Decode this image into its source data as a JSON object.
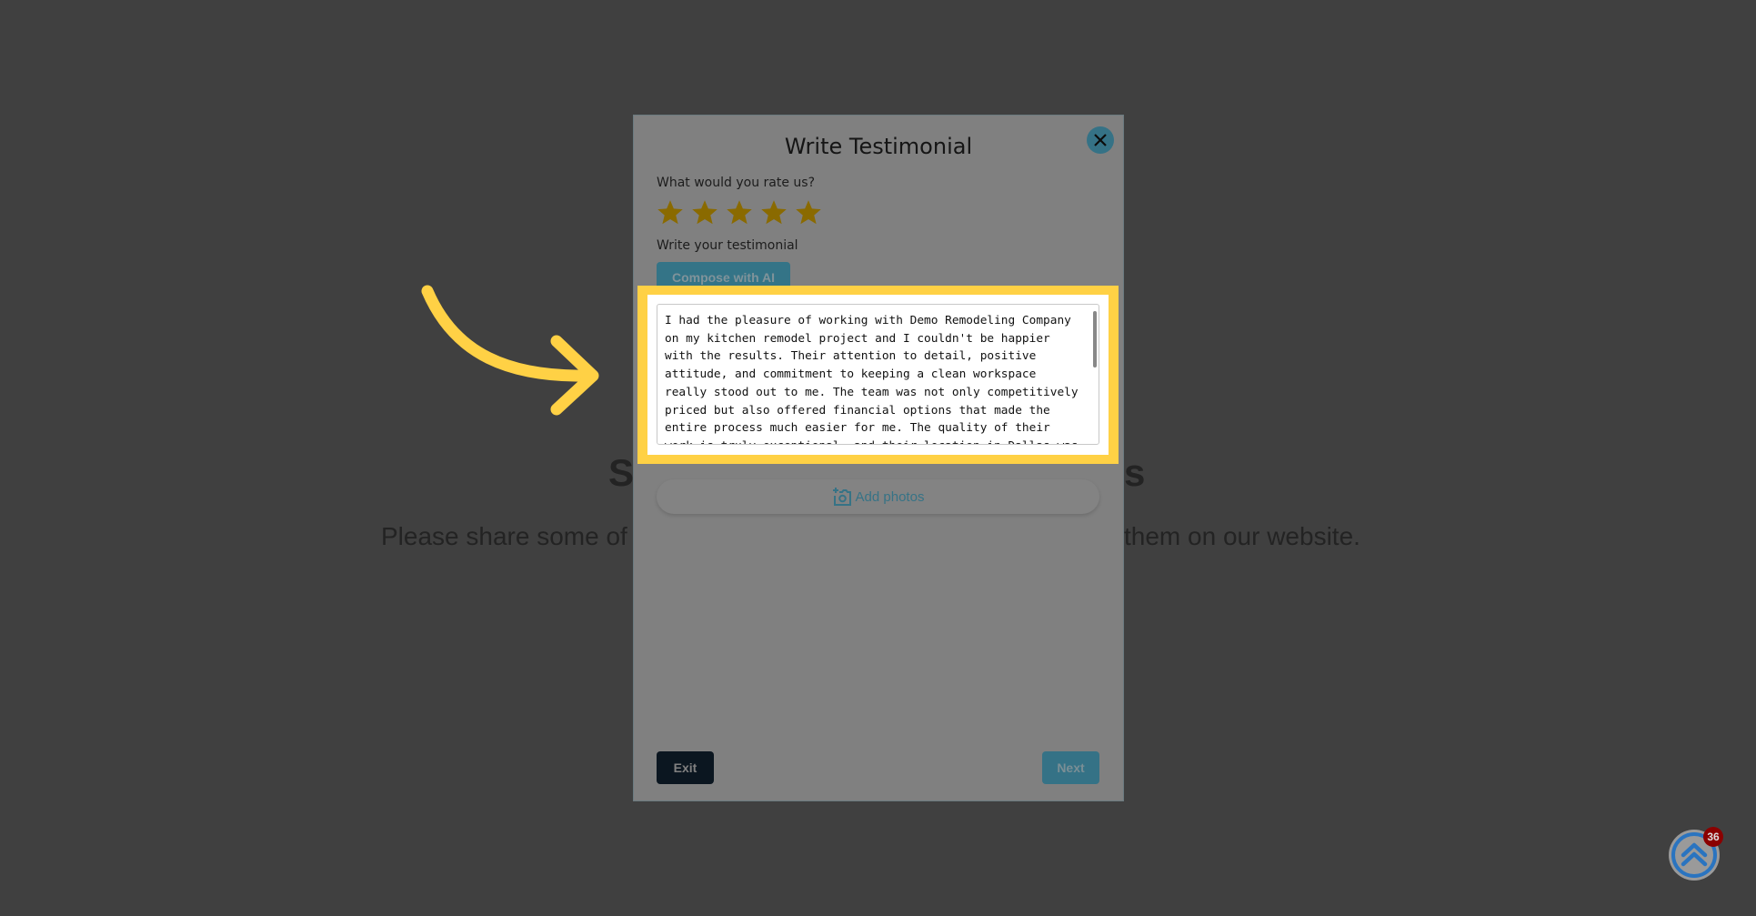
{
  "background": {
    "heading_left": "S",
    "heading_right": "s",
    "subtitle_left": "Please share some of",
    "subtitle_right": "them on our website."
  },
  "modal": {
    "title": "Write Testimonial",
    "close_icon": "close-icon",
    "rating_label": "What would you rate us?",
    "rating": 5,
    "rating_max": 5,
    "testimonial_label": "Write your testimonial",
    "compose_label": "Compose with AI",
    "testimonial_text": "I had the pleasure of working with Demo Remodeling Company on my kitchen remodel project and I couldn't be happier with the results. Their attention to detail, positive attitude, and commitment to keeping a clean workspace really stood out to me. The team was not only competitively priced but also offered financial options that made the entire process much easier for me. The quality of their work is truly exceptional, and their location in Dallas was conveniently",
    "add_photos_label": "Add photos",
    "exit_label": "Exit",
    "next_label": "Next"
  },
  "widget": {
    "badge_count": "36"
  },
  "colors": {
    "accent": "#357286",
    "highlight": "#ffd145",
    "star": "#8a6a00"
  }
}
